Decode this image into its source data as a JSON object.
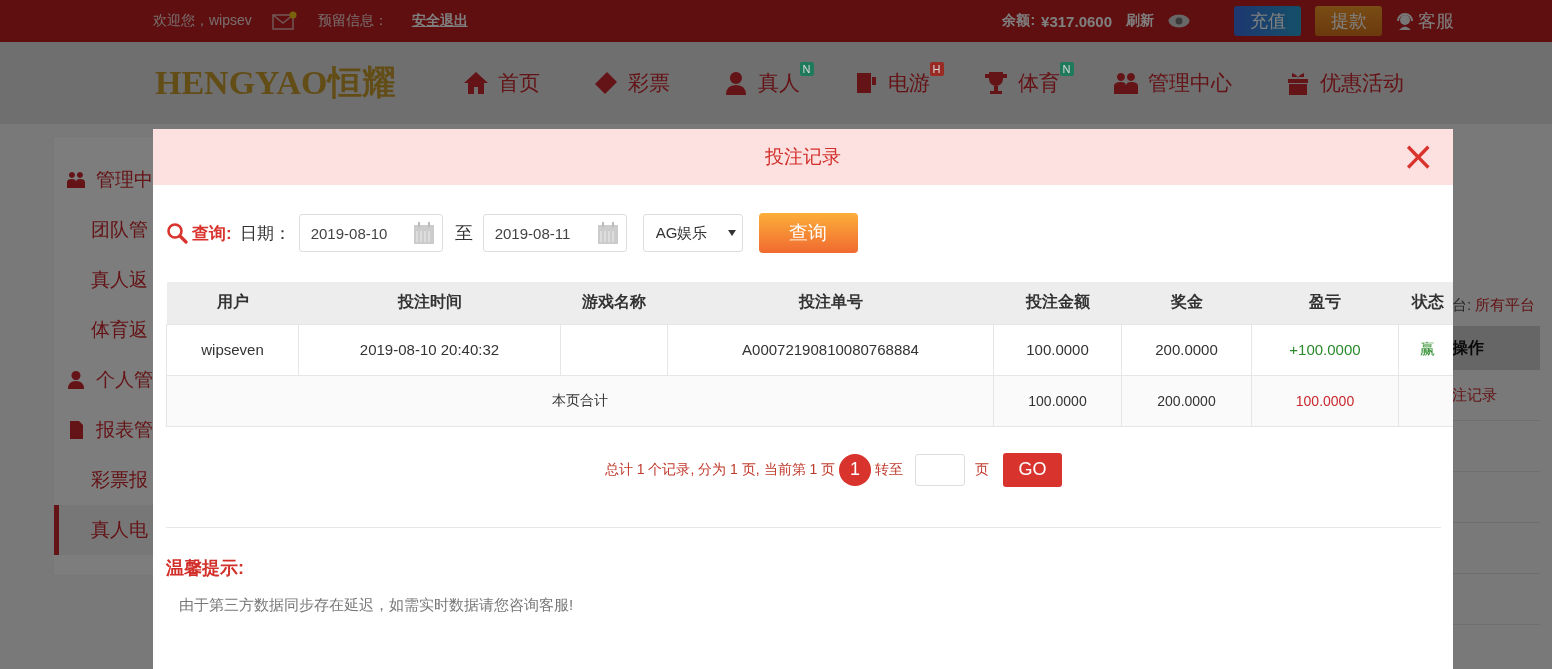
{
  "top_bar": {
    "welcome": "欢迎您，wipsev",
    "reserved_label": "预留信息：",
    "logout": "安全退出",
    "balance_label": "余额:",
    "balance": "¥317.0600",
    "refresh": "刷新",
    "deposit": "充值",
    "withdraw": "提款",
    "service": "客服"
  },
  "nav": {
    "logo": "HENGYAO恒耀",
    "items": [
      {
        "label": "首页"
      },
      {
        "label": "彩票"
      },
      {
        "label": "真人",
        "badge": "N",
        "color": "#1f7a5c"
      },
      {
        "label": "电游",
        "badge": "H",
        "color": "#9a2a24"
      },
      {
        "label": "体育",
        "badge": "N",
        "color": "#1f7a5c"
      },
      {
        "label": "管理中心"
      },
      {
        "label": "优惠活动"
      }
    ]
  },
  "sidebar": {
    "items": [
      {
        "kind": "group",
        "label": "管理中"
      },
      {
        "kind": "item",
        "label": "团队管",
        "selected": false
      },
      {
        "kind": "item",
        "label": "真人返",
        "selected": false
      },
      {
        "kind": "item",
        "label": "体育返",
        "selected": false
      },
      {
        "kind": "group",
        "label": "个人管"
      },
      {
        "kind": "group",
        "label": "报表管"
      },
      {
        "kind": "item",
        "label": "彩票报",
        "selected": false
      },
      {
        "kind": "item",
        "label": "真人电",
        "selected": true
      }
    ]
  },
  "main": {
    "platform_label": "台:",
    "platform_value": "所有平台",
    "column": "操作",
    "link": "注记录"
  },
  "modal": {
    "title": "投注记录",
    "close": "×",
    "search": {
      "label": "查询:",
      "date_label": "日期：",
      "from": "2019-08-10",
      "to_label": "至",
      "to": "2019-08-11",
      "platform": "AG娱乐",
      "button": "查询"
    },
    "table": {
      "columns": [
        "用户",
        "投注时间",
        "游戏名称",
        "投注单号",
        "投注金额",
        "奖金",
        "盈亏",
        "状态"
      ],
      "rows": [
        {
          "kind": "data",
          "cells": [
            "wipseven",
            "2019-08-10 20:40:32",
            "",
            "A00072190810080768884",
            "100.0000",
            "200.0000",
            "+100.0000",
            "赢"
          ]
        },
        {
          "kind": "total",
          "cells": [
            {
              "text": "本页合计",
              "colspan": 4
            },
            {
              "text": "100.0000"
            },
            {
              "text": "200.0000"
            },
            {
              "text": "100.0000"
            },
            {
              "text": ""
            }
          ]
        }
      ]
    },
    "pagination": {
      "summary": "总计 1 个记录, 分为 1 页, 当前第 1 页",
      "current": "1",
      "goto_label": "转至",
      "page_label": "页",
      "button": "GO"
    },
    "tips": {
      "title": "温馨提示:",
      "text": "由于第三方数据同步存在延迟，如需实时数据请您咨询客服!"
    }
  }
}
